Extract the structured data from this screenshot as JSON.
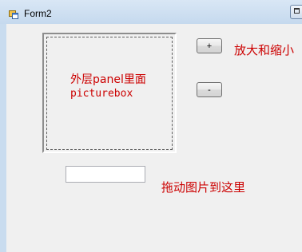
{
  "window": {
    "title": "Form2",
    "icon": "form-app-icon"
  },
  "panel": {
    "label_line1": "外层panel里面",
    "label_line2": "picturebox"
  },
  "buttons": {
    "zoom_in_label": "+",
    "zoom_out_label": "-",
    "zoom_caption": "放大和缩小"
  },
  "drag": {
    "input_value": "",
    "caption": "拖动图片到这里"
  },
  "colors": {
    "label_red": "#cc0000",
    "form_background": "#f0f0f0",
    "titlebar": "#c9dcef"
  }
}
